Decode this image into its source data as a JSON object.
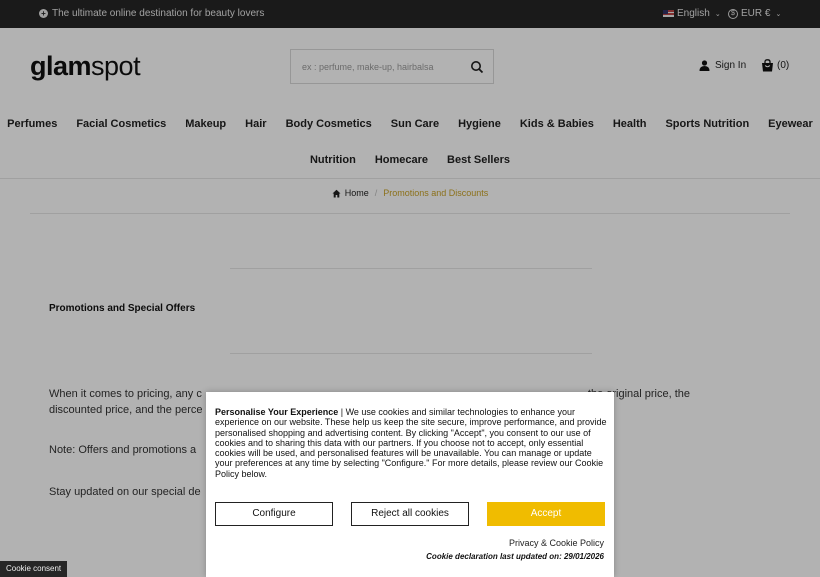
{
  "topbar": {
    "promo": "The ultimate online destination for beauty lovers",
    "language": "English",
    "currency": "EUR €"
  },
  "header": {
    "logo_bold": "glam",
    "logo_light": "spot",
    "search_placeholder": "ex : perfume, make-up, hairbalsa",
    "signin": "Sign In",
    "cart_count": "(0)"
  },
  "nav": {
    "row1": [
      "Perfumes",
      "Facial Cosmetics",
      "Makeup",
      "Hair",
      "Body Cosmetics",
      "Sun Care",
      "Hygiene",
      "Kids & Babies",
      "Health",
      "Sports Nutrition",
      "Eyewear"
    ],
    "row2": [
      "Nutrition",
      "Homecare",
      "Best Sellers"
    ]
  },
  "breadcrumb": {
    "home": "Home",
    "separator": "/",
    "current": "Promotions and Discounts"
  },
  "content": {
    "title": "Promotions and Special Offers",
    "para1_start": "When it comes to pricing, any c",
    "para1_end": " the original price, the",
    "para1_line2": "discounted price, and the perce",
    "para2": "Note: Offers and promotions a",
    "para3": "Stay updated on our special de"
  },
  "cookie": {
    "heading": "Personalise Your Experience",
    "body": " | We use cookies and similar technologies to enhance your experience on our website. These help us keep the site secure, improve performance, and provide personalised shopping and advertising content. By clicking \"Accept\", you consent to our use of cookies and to sharing this data with our partners. If you choose not to accept, only essential cookies will be used, and personalised features will be unavailable. You can manage or update your preferences at any time by selecting \"Configure.\" For more details, please review our Cookie Policy below.",
    "configure": "Configure",
    "reject": "Reject all cookies",
    "accept": "Accept",
    "policy_link": "Privacy & Cookie Policy",
    "updated": "Cookie declaration last updated on: 29/01/2026"
  },
  "consent_tab": "Cookie consent",
  "colors": {
    "accent": "#f0bc00",
    "breadcrumb_current": "#c9a227",
    "topbar": "#262626"
  }
}
